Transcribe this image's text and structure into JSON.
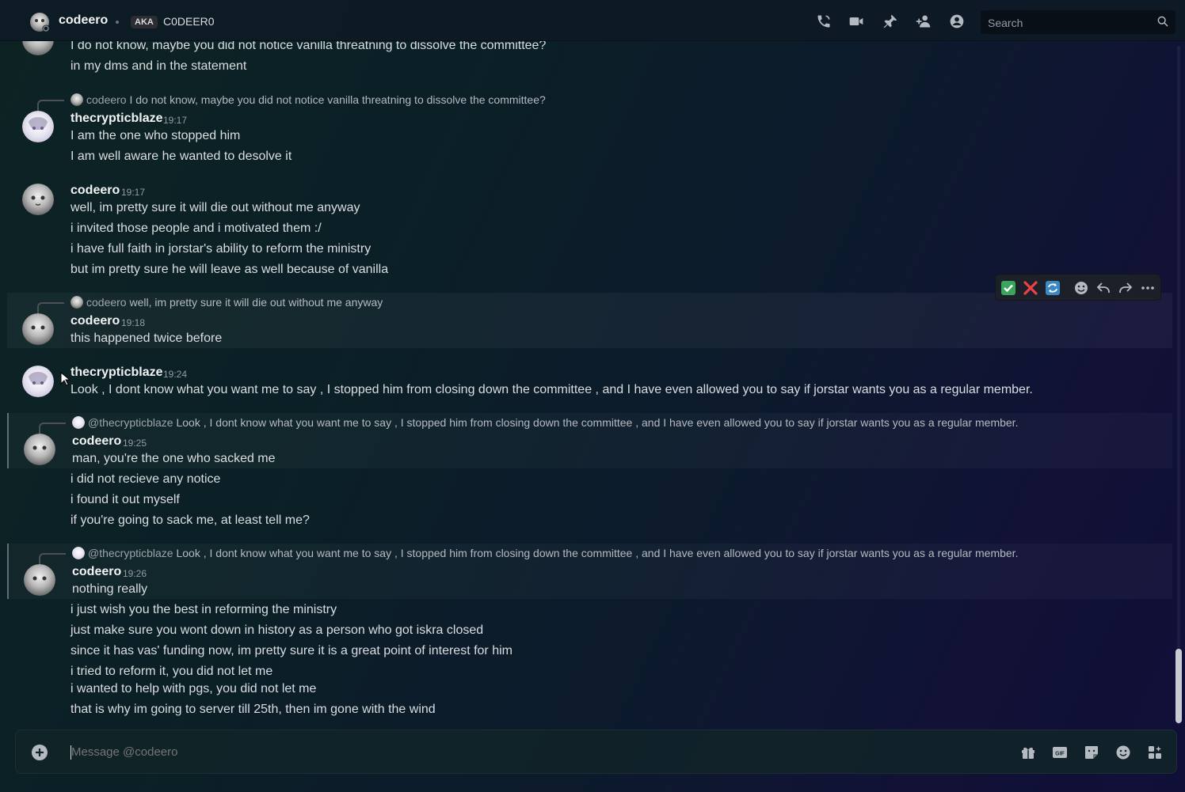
{
  "header": {
    "dm_name": "codeero",
    "aka_badge": "AKA",
    "aka_name": "C0DEER0",
    "icons": [
      "phone-icon",
      "video-icon",
      "pin-icon",
      "add-friends-icon",
      "profile-icon"
    ],
    "search_placeholder": "Search"
  },
  "messages": [
    {
      "lines": [
        "I do not know, maybe you did not notice vanilla threatning to dissolve the committee?",
        "in my dms and in the statement"
      ]
    },
    {
      "reply_name": "codeero",
      "reply_text": "I do not know, maybe you did not notice vanilla threatning to dissolve the committee?",
      "author": "thecrypticblaze",
      "time": "19:17",
      "lines": [
        "I am the one who stopped him",
        "I am well aware he wanted to desolve it"
      ]
    },
    {
      "author": "codeero",
      "time": "19:17",
      "lines": [
        "well, im pretty sure it will die out without me anyway",
        "i invited those people and i motivated them :/",
        "i have full faith in jorstar's ability to reform the ministry",
        "but im pretty sure he will leave as well because of vanilla"
      ]
    },
    {
      "reply_name": "codeero",
      "reply_text": "well, im pretty sure it will die out without me anyway",
      "author": "codeero",
      "time": "19:18",
      "lines": [
        "this happened twice before"
      ]
    },
    {
      "author": "thecrypticblaze",
      "time": "19:24",
      "lines": [
        "Look , I dont know what you want me to say , I stopped him from closing down the committee , and I have even allowed you to say if jorstar wants you as a regular member."
      ]
    },
    {
      "reply_name": "@thecrypticblaze",
      "reply_text": "Look , I dont know what you want me to say , I stopped him from closing down the committee , and I have even allowed you to say if jorstar wants you as a regular member.",
      "author": "codeero",
      "time": "19:25",
      "lines": [
        "man, you're the one who sacked me",
        "i did not recieve any notice",
        "i found it out myself",
        "if you're going to sack me, at least tell me?"
      ]
    },
    {
      "reply_name": "@thecrypticblaze",
      "reply_text": "Look , I dont know what you want me to say , I stopped him from closing down the committee , and I have even allowed you to say if jorstar wants you as a regular member.",
      "author": "codeero",
      "time": "19:26",
      "lines": [
        "nothing really",
        "i just wish you the best in reforming the ministry",
        "just make sure you wont down in history as a person who got iskra closed",
        "since it has vas' funding now, im pretty sure it is a great point of interest for him",
        "i tried to reform it, you did not let me",
        "i wanted to help with pgs, you did not let me",
        "that is why im going to server till 25th, then im gone with the wind"
      ]
    }
  ],
  "action_bar": {
    "icons": [
      "check-reaction-icon",
      "cross-reaction-icon",
      "repeat-reaction-icon",
      "add-reaction-icon",
      "reply-icon",
      "forward-icon",
      "more-icon"
    ]
  },
  "composer": {
    "placeholder": "Message @codeero",
    "icons": [
      "gift-icon",
      "gif-icon",
      "sticker-icon",
      "emoji-icon",
      "apps-icon"
    ]
  },
  "colors": {
    "accent_green": "#3ba55c",
    "accent_red": "#ed4245",
    "accent_blue": "#5865f2"
  }
}
